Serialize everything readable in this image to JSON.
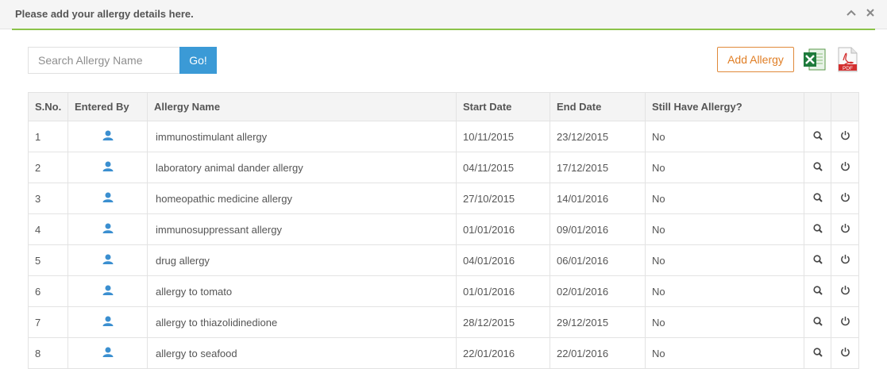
{
  "panel": {
    "title": "Please add your allergy details here.",
    "header_icons": [
      "chevron-up-icon",
      "close-icon"
    ]
  },
  "toolbar": {
    "search_placeholder": "Search Allergy Name",
    "search_value": "",
    "go_label": "Go!",
    "add_label": "Add Allergy",
    "export_icons": [
      "excel-icon",
      "pdf-icon"
    ],
    "add_color": "#e07e25",
    "go_color": "#3b9ad6",
    "accent_color": "#8bc34a"
  },
  "table": {
    "headers": [
      "S.No.",
      "Entered By",
      "Allergy Name",
      "Start Date",
      "End Date",
      "Still Have Allergy?",
      "",
      ""
    ],
    "rows": [
      {
        "sno": "1",
        "name": "immunostimulant allergy",
        "start": "10/11/2015",
        "end": "23/12/2015",
        "still": "No"
      },
      {
        "sno": "2",
        "name": "laboratory animal dander allergy",
        "start": "04/11/2015",
        "end": "17/12/2015",
        "still": "No"
      },
      {
        "sno": "3",
        "name": "homeopathic medicine allergy",
        "start": "27/10/2015",
        "end": "14/01/2016",
        "still": "No"
      },
      {
        "sno": "4",
        "name": "immunosuppressant allergy",
        "start": "01/01/2016",
        "end": "09/01/2016",
        "still": "No"
      },
      {
        "sno": "5",
        "name": "drug allergy",
        "start": "04/01/2016",
        "end": "06/01/2016",
        "still": "No"
      },
      {
        "sno": "6",
        "name": "allergy to tomato",
        "start": "01/01/2016",
        "end": "02/01/2016",
        "still": "No"
      },
      {
        "sno": "7",
        "name": "allergy to thiazolidinedione",
        "start": "28/12/2015",
        "end": "29/12/2015",
        "still": "No"
      },
      {
        "sno": "8",
        "name": "allergy to seafood",
        "start": "22/01/2016",
        "end": "22/01/2016",
        "still": "No"
      }
    ],
    "row_icons": [
      "user-icon",
      "search-icon",
      "power-icon"
    ]
  }
}
